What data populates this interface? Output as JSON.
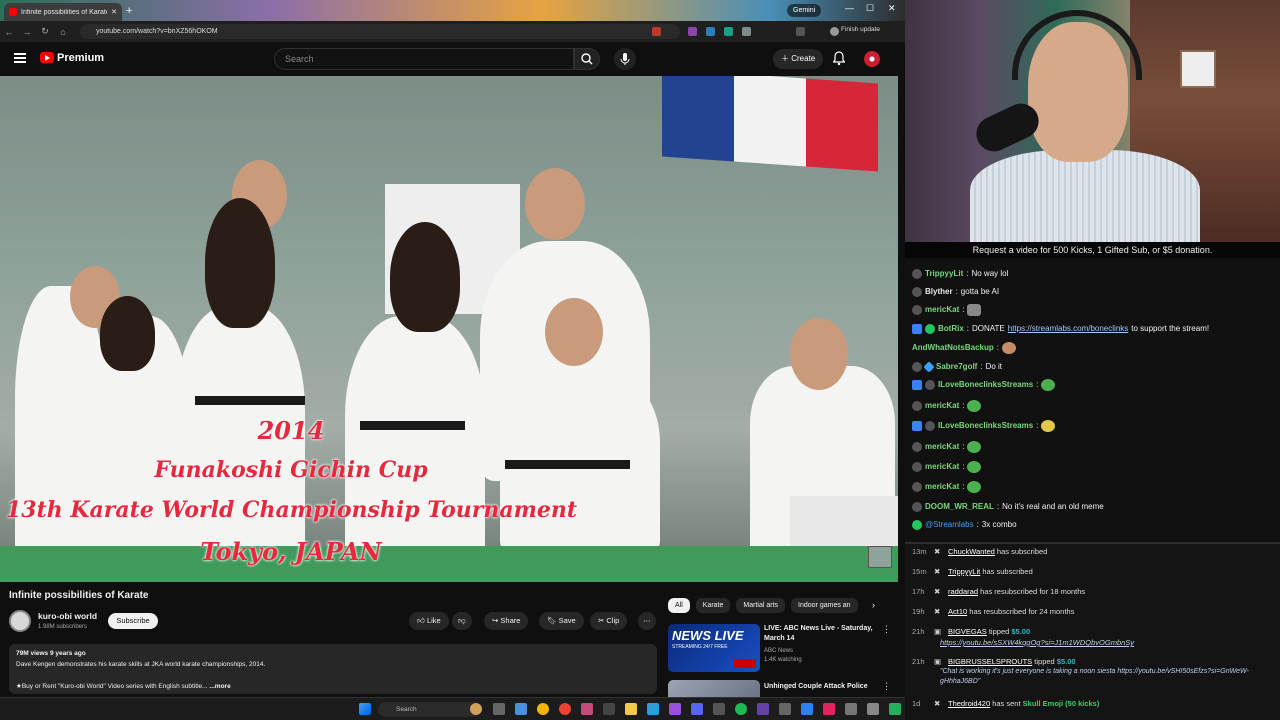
{
  "browser": {
    "tab_title": "Infinite possibilities of Karate",
    "url": "youtube.com/watch?v=bnXZ56hOKOM",
    "gemini_label": "Gemini",
    "update_label": "Finish update"
  },
  "youtube": {
    "logo_text": "Premium",
    "search_placeholder": "Search",
    "create_label": "Create",
    "video": {
      "overlay_line1": "2014",
      "overlay_line2": "Funakoshi Gichin Cup",
      "overlay_line3": "13th Karate World Championship Tournament",
      "overlay_line4": "Tokyo, JAPAN"
    },
    "title": "Infinite possibilities of Karate",
    "channel": {
      "name": "kuro-obi world",
      "subscribers": "1.98M subscribers",
      "subscribe_label": "Subscribe"
    },
    "actions": {
      "like": "Like",
      "share": "Share",
      "save": "Save",
      "clip": "Clip"
    },
    "description": {
      "stats": "79M views  9 years ago",
      "line1": "Dave Kengen demonstrates his karate skills at JKA world karate championships, 2014.",
      "line2": "★Buy or Rent \"Kuro-obi World\" Video series with English subtitle...",
      "more": "...more"
    },
    "chips": [
      "All",
      "Karate",
      "Martial arts",
      "Indoor games an"
    ],
    "recommendations": [
      {
        "title": "LIVE: ABC News Live - Saturday, March 14",
        "channel": "ABC News",
        "meta": "1.4K watching",
        "thumb_text": "NEWS LIVE",
        "thumb_sub": "STREAMING 24/7 FREE"
      },
      {
        "title": "Unhinged Couple Attack Police",
        "channel": "",
        "meta": "",
        "thumb_text": "",
        "thumb_sub": ""
      }
    ]
  },
  "taskbar": {
    "search_label": "Search"
  },
  "chat": {
    "banner": "Request a video for 500 Kicks, 1 Gifted Sub, or $5 donation.",
    "messages": [
      {
        "user": "TrippyyLit",
        "text": "No way lol",
        "color": "#7cd67c"
      },
      {
        "user": "Blyther",
        "text": "gotta be AI",
        "color": "#e8e8e8"
      },
      {
        "user": "mericKat",
        "text": "",
        "color": "#7cd67c"
      },
      {
        "user": "BotRix",
        "text": "DONATE ",
        "link": "https://streamlabs.com/boneclinks",
        "tail": " to support the stream!",
        "color": "#7cd67c"
      },
      {
        "user": "AndWhatNotsBackup",
        "text": "",
        "color": "#7cd67c"
      },
      {
        "user": "Sabre7golf",
        "text": "Do it",
        "color": "#7cd67c"
      },
      {
        "user": "ILoveBoneclinksStreams",
        "text": "",
        "color": "#7cd67c"
      },
      {
        "user": "mericKat",
        "text": "",
        "color": "#7cd67c"
      },
      {
        "user": "ILoveBoneclinksStreams",
        "text": "",
        "color": "#7cd67c"
      },
      {
        "user": "mericKat",
        "text": "",
        "color": "#7cd67c"
      },
      {
        "user": "mericKat",
        "text": "",
        "color": "#7cd67c"
      },
      {
        "user": "mericKat",
        "text": "",
        "color": "#7cd67c"
      },
      {
        "user": "DOOM_WR_REAL",
        "text": "No it's real and an old meme",
        "color": "#7cd67c"
      },
      {
        "user": "@Streamlabs",
        "text": "3x  combo",
        "color": "#3aa0ff"
      }
    ]
  },
  "events": [
    {
      "time": "13m",
      "user": "ChuckWanted",
      "text": " has subscribed"
    },
    {
      "time": "15m",
      "user": "TrippyyLit",
      "text": " has subscribed"
    },
    {
      "time": "17h",
      "user": "raddarad",
      "text": " has resubscribed for 18 months"
    },
    {
      "time": "19h",
      "user": "Act10",
      "text": " has resubscribed for 24 months"
    },
    {
      "time": "21h",
      "user": "BIGVEGAS",
      "text": " tipped ",
      "amount": "$5.00",
      "note": "https://youtu.be/sSXW4kqgOg?si=J1m1WDQbvOGmbnSy"
    },
    {
      "time": "21h",
      "user": "BIGBRUSSELSPROUTS",
      "text": " tipped ",
      "amount": "$5.00",
      "note": "\"Chat is working it's just everyone is taking a noon siesta https://youtu.be/vSHI50sEfzs?si=GnWeW-gHhhaJ6BD\""
    },
    {
      "time": "1d",
      "user": "Thedroid420",
      "text": " has sent ",
      "amount": "Skull Emoji (50 kicks)"
    }
  ]
}
